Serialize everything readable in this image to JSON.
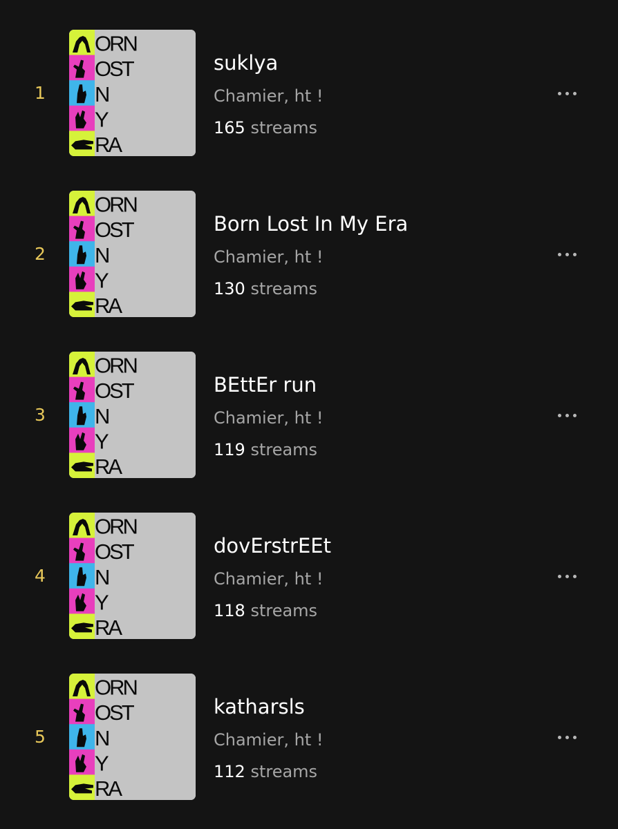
{
  "colors": {
    "background": "#141414",
    "rank": "#e8c85a",
    "title": "#ffffff",
    "subtitle": "#a6a6a6",
    "cover_strip": [
      "#d6f23a",
      "#e83fbd",
      "#3fb5ea",
      "#e83fbd",
      "#d6f23a"
    ],
    "cover_gray": "#c4c4c4"
  },
  "cover_art": {
    "lines": [
      "ORN",
      "OST",
      "N",
      "Y",
      "RA"
    ]
  },
  "tracks": [
    {
      "rank": "1",
      "title": "suklya",
      "artist": "Chamier, ht !",
      "count": "165",
      "unit": "streams",
      "menu_icon": "more-horizontal-icon"
    },
    {
      "rank": "2",
      "title": "Born Lost In My Era",
      "artist": "Chamier, ht !",
      "count": "130",
      "unit": "streams",
      "menu_icon": "more-horizontal-icon"
    },
    {
      "rank": "3",
      "title": "BEttEr run",
      "artist": "Chamier, ht !",
      "count": "119",
      "unit": "streams",
      "menu_icon": "more-horizontal-icon"
    },
    {
      "rank": "4",
      "title": "dovErstrEEt",
      "artist": "Chamier, ht !",
      "count": "118",
      "unit": "streams",
      "menu_icon": "more-horizontal-icon"
    },
    {
      "rank": "5",
      "title": "katharsls",
      "artist": "Chamier, ht !",
      "count": "112",
      "unit": "streams",
      "menu_icon": "more-horizontal-icon"
    }
  ]
}
